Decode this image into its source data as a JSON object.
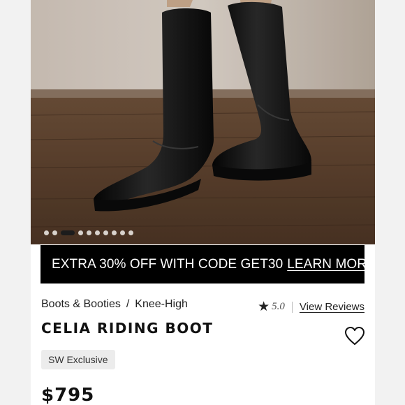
{
  "product_image": {
    "alt": ""
  },
  "carousel": {
    "total": 10,
    "active_index": 2
  },
  "promo": {
    "text": "EXTRA 30% OFF WITH CODE GET30",
    "link": "LEARN MORE"
  },
  "breadcrumb": {
    "category": "Boots & Booties",
    "separator": "/",
    "subcategory": "Knee-High"
  },
  "rating": {
    "score": "5.0",
    "reviews_label": "View Reviews"
  },
  "product": {
    "name": "CELIA RIDING BOOT",
    "badge": "SW Exclusive",
    "price": "$795"
  }
}
